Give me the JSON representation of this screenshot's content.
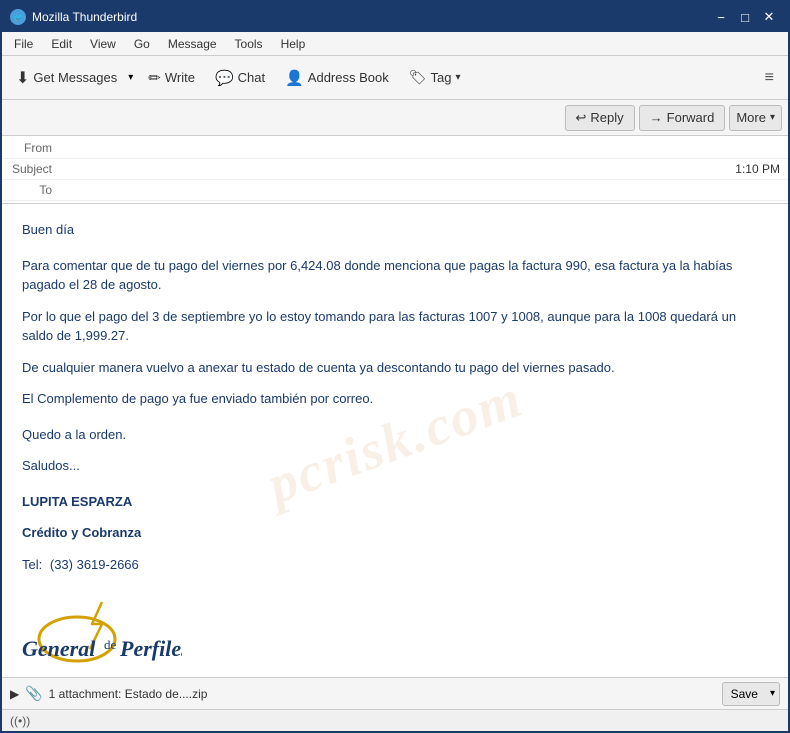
{
  "window": {
    "title": "Mozilla Thunderbird",
    "controls": {
      "minimize": "−",
      "maximize": "□",
      "close": "✕"
    }
  },
  "menu": {
    "items": [
      "File",
      "Edit",
      "View",
      "Go",
      "Message",
      "Tools",
      "Help"
    ]
  },
  "toolbar": {
    "get_messages_label": "Get Messages",
    "write_label": "Write",
    "chat_label": "Chat",
    "address_book_label": "Address Book",
    "tag_label": "Tag",
    "menu_icon": "≡"
  },
  "action_buttons": {
    "reply_label": "Reply",
    "forward_label": "Forward",
    "more_label": "More"
  },
  "header": {
    "from_label": "From",
    "from_value": "",
    "subject_label": "Subject",
    "time": "1:10 PM",
    "to_label": "To",
    "to_value": ""
  },
  "body": {
    "greeting": "Buen día",
    "paragraph1": "Para comentar que de tu pago del viernes por  6,424.08 donde menciona que pagas la factura 990, esa factura ya la habías pagado el 28 de agosto.",
    "paragraph2": "Por lo que el pago del 3 de septiembre yo lo estoy tomando para las facturas 1007 y 1008, aunque para la 1008 quedará un saldo de 1,999.27.",
    "paragraph3": "De cualquier manera vuelvo a anexar tu estado de cuenta ya descontando tu pago del viernes pasado.",
    "paragraph4": "El Complemento de pago ya fue enviado también por correo.",
    "sign1": "Quedo a la orden.",
    "sign2": "Saludos...",
    "name": "LUPITA ESPARZA",
    "dept": "Crédito y Cobranza",
    "tel_label": "Tel:",
    "tel_value": "(33) 3619-2666"
  },
  "logo": {
    "company_name": "General de Perfiles",
    "de_text": "de"
  },
  "attachment": {
    "count": "1 attachment: Estado de....zip",
    "save_label": "Save"
  },
  "status": {
    "icon": "((•))"
  }
}
